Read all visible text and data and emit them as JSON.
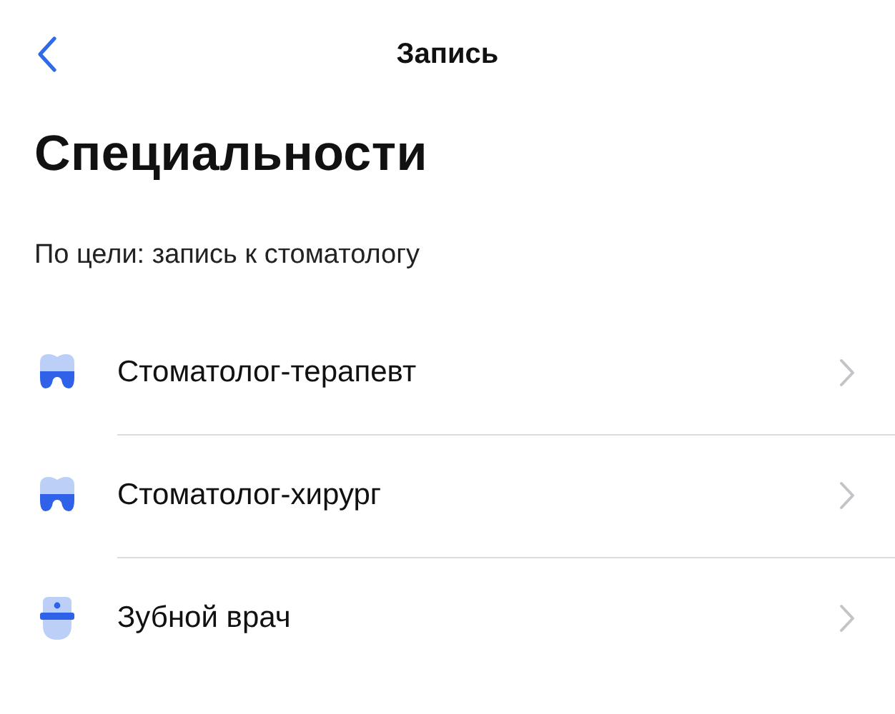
{
  "header": {
    "title": "Запись"
  },
  "heading": "Специальности",
  "subtitle": "По цели: запись к стоматологу",
  "items": [
    {
      "label": "Стоматолог-терапевт",
      "kind": "tooth"
    },
    {
      "label": "Стоматолог-хирург",
      "kind": "tooth"
    },
    {
      "label": "Зубной врач",
      "kind": "doctor"
    }
  ]
}
